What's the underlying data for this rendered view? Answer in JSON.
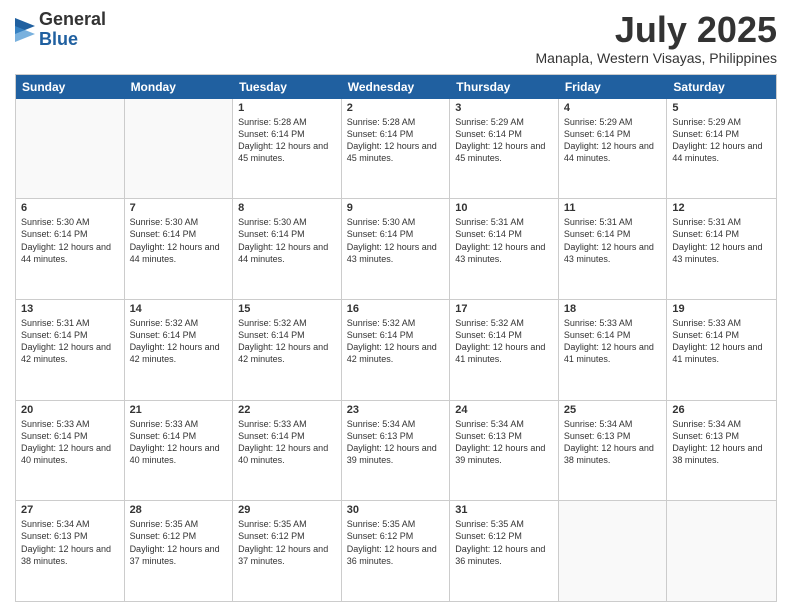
{
  "header": {
    "logo_general": "General",
    "logo_blue": "Blue",
    "month_title": "July 2025",
    "location": "Manapla, Western Visayas, Philippines"
  },
  "days_of_week": [
    "Sunday",
    "Monday",
    "Tuesday",
    "Wednesday",
    "Thursday",
    "Friday",
    "Saturday"
  ],
  "weeks": [
    [
      {
        "day": "",
        "info": "",
        "empty": true
      },
      {
        "day": "",
        "info": "",
        "empty": true
      },
      {
        "day": "1",
        "info": "Sunrise: 5:28 AM\nSunset: 6:14 PM\nDaylight: 12 hours and 45 minutes."
      },
      {
        "day": "2",
        "info": "Sunrise: 5:28 AM\nSunset: 6:14 PM\nDaylight: 12 hours and 45 minutes."
      },
      {
        "day": "3",
        "info": "Sunrise: 5:29 AM\nSunset: 6:14 PM\nDaylight: 12 hours and 45 minutes."
      },
      {
        "day": "4",
        "info": "Sunrise: 5:29 AM\nSunset: 6:14 PM\nDaylight: 12 hours and 44 minutes."
      },
      {
        "day": "5",
        "info": "Sunrise: 5:29 AM\nSunset: 6:14 PM\nDaylight: 12 hours and 44 minutes."
      }
    ],
    [
      {
        "day": "6",
        "info": "Sunrise: 5:30 AM\nSunset: 6:14 PM\nDaylight: 12 hours and 44 minutes."
      },
      {
        "day": "7",
        "info": "Sunrise: 5:30 AM\nSunset: 6:14 PM\nDaylight: 12 hours and 44 minutes."
      },
      {
        "day": "8",
        "info": "Sunrise: 5:30 AM\nSunset: 6:14 PM\nDaylight: 12 hours and 44 minutes."
      },
      {
        "day": "9",
        "info": "Sunrise: 5:30 AM\nSunset: 6:14 PM\nDaylight: 12 hours and 43 minutes."
      },
      {
        "day": "10",
        "info": "Sunrise: 5:31 AM\nSunset: 6:14 PM\nDaylight: 12 hours and 43 minutes."
      },
      {
        "day": "11",
        "info": "Sunrise: 5:31 AM\nSunset: 6:14 PM\nDaylight: 12 hours and 43 minutes."
      },
      {
        "day": "12",
        "info": "Sunrise: 5:31 AM\nSunset: 6:14 PM\nDaylight: 12 hours and 43 minutes."
      }
    ],
    [
      {
        "day": "13",
        "info": "Sunrise: 5:31 AM\nSunset: 6:14 PM\nDaylight: 12 hours and 42 minutes."
      },
      {
        "day": "14",
        "info": "Sunrise: 5:32 AM\nSunset: 6:14 PM\nDaylight: 12 hours and 42 minutes."
      },
      {
        "day": "15",
        "info": "Sunrise: 5:32 AM\nSunset: 6:14 PM\nDaylight: 12 hours and 42 minutes."
      },
      {
        "day": "16",
        "info": "Sunrise: 5:32 AM\nSunset: 6:14 PM\nDaylight: 12 hours and 42 minutes."
      },
      {
        "day": "17",
        "info": "Sunrise: 5:32 AM\nSunset: 6:14 PM\nDaylight: 12 hours and 41 minutes."
      },
      {
        "day": "18",
        "info": "Sunrise: 5:33 AM\nSunset: 6:14 PM\nDaylight: 12 hours and 41 minutes."
      },
      {
        "day": "19",
        "info": "Sunrise: 5:33 AM\nSunset: 6:14 PM\nDaylight: 12 hours and 41 minutes."
      }
    ],
    [
      {
        "day": "20",
        "info": "Sunrise: 5:33 AM\nSunset: 6:14 PM\nDaylight: 12 hours and 40 minutes."
      },
      {
        "day": "21",
        "info": "Sunrise: 5:33 AM\nSunset: 6:14 PM\nDaylight: 12 hours and 40 minutes."
      },
      {
        "day": "22",
        "info": "Sunrise: 5:33 AM\nSunset: 6:14 PM\nDaylight: 12 hours and 40 minutes."
      },
      {
        "day": "23",
        "info": "Sunrise: 5:34 AM\nSunset: 6:13 PM\nDaylight: 12 hours and 39 minutes."
      },
      {
        "day": "24",
        "info": "Sunrise: 5:34 AM\nSunset: 6:13 PM\nDaylight: 12 hours and 39 minutes."
      },
      {
        "day": "25",
        "info": "Sunrise: 5:34 AM\nSunset: 6:13 PM\nDaylight: 12 hours and 38 minutes."
      },
      {
        "day": "26",
        "info": "Sunrise: 5:34 AM\nSunset: 6:13 PM\nDaylight: 12 hours and 38 minutes."
      }
    ],
    [
      {
        "day": "27",
        "info": "Sunrise: 5:34 AM\nSunset: 6:13 PM\nDaylight: 12 hours and 38 minutes."
      },
      {
        "day": "28",
        "info": "Sunrise: 5:35 AM\nSunset: 6:12 PM\nDaylight: 12 hours and 37 minutes."
      },
      {
        "day": "29",
        "info": "Sunrise: 5:35 AM\nSunset: 6:12 PM\nDaylight: 12 hours and 37 minutes."
      },
      {
        "day": "30",
        "info": "Sunrise: 5:35 AM\nSunset: 6:12 PM\nDaylight: 12 hours and 36 minutes."
      },
      {
        "day": "31",
        "info": "Sunrise: 5:35 AM\nSunset: 6:12 PM\nDaylight: 12 hours and 36 minutes."
      },
      {
        "day": "",
        "info": "",
        "empty": true
      },
      {
        "day": "",
        "info": "",
        "empty": true
      }
    ]
  ]
}
